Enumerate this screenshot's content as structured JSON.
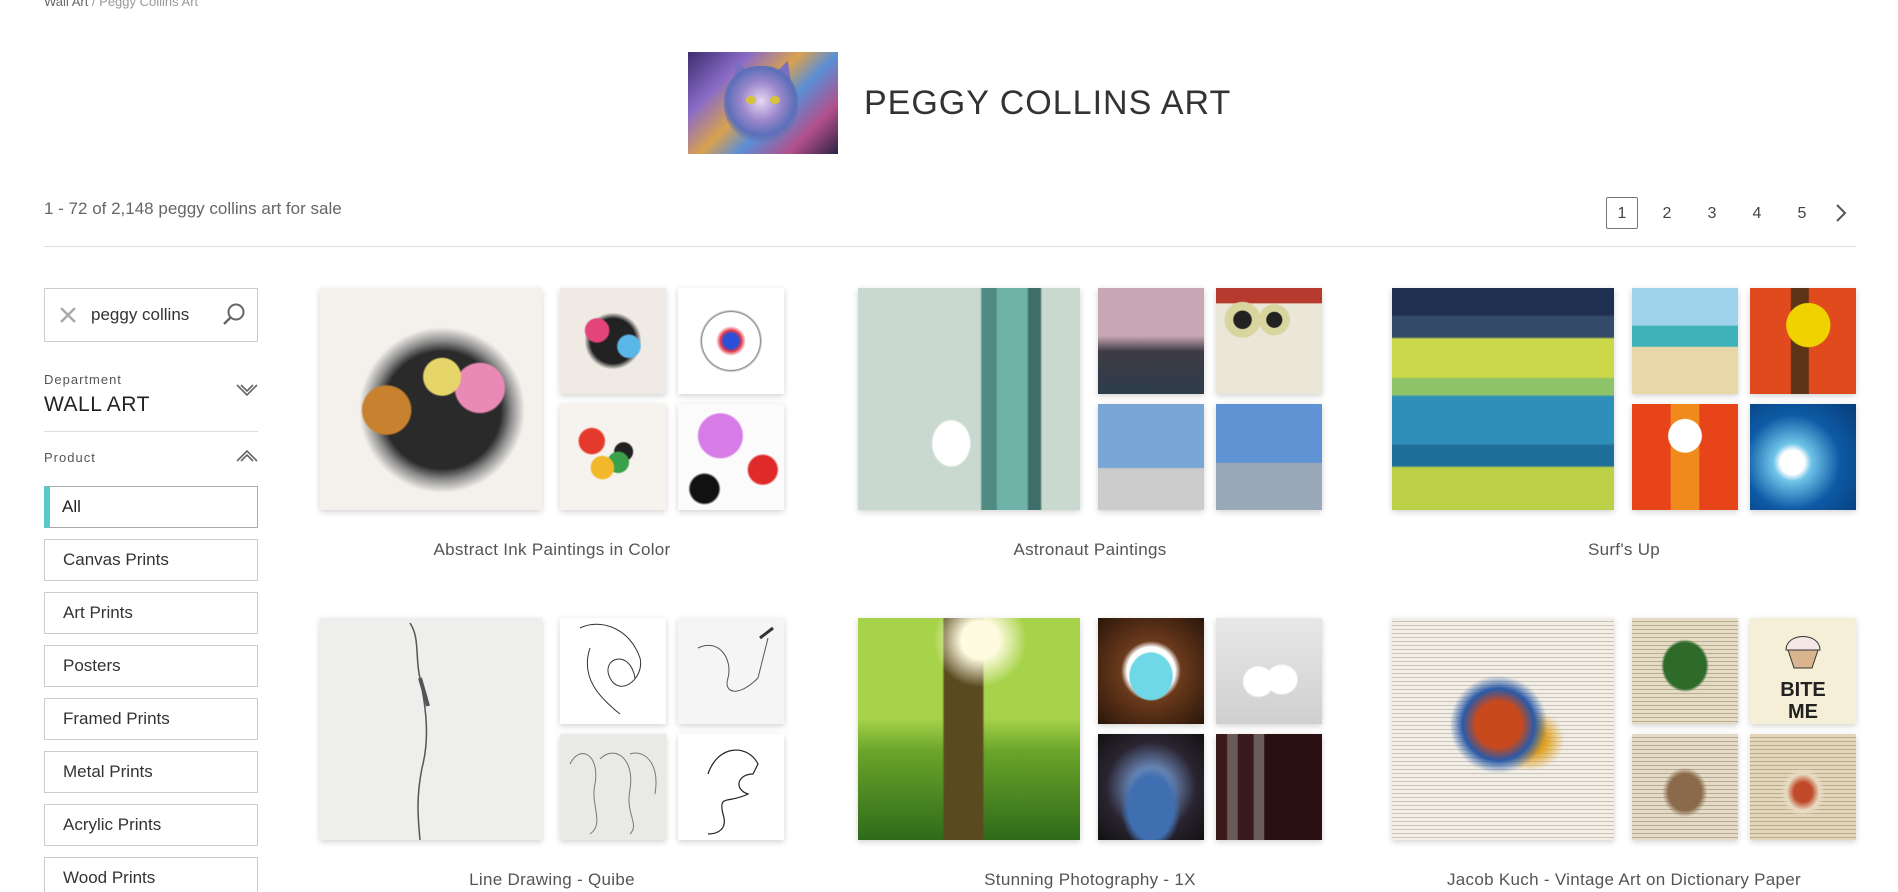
{
  "breadcrumb": {
    "parent": "Wall Art",
    "separator": " / ",
    "current": "Peggy Collins Art"
  },
  "artist": {
    "name": "PEGGY COLLINS ART"
  },
  "results": {
    "count_text": "1 - 72 of 2,148 peggy collins art for sale"
  },
  "pagination": {
    "pages": [
      "1",
      "2",
      "3",
      "4",
      "5"
    ],
    "active": "1"
  },
  "search": {
    "value": "peggy collins"
  },
  "filters": {
    "department": {
      "label": "Department",
      "value": "WALL ART"
    },
    "product": {
      "label": "Product",
      "options": [
        "All",
        "Canvas Prints",
        "Art Prints",
        "Posters",
        "Framed Prints",
        "Metal Prints",
        "Acrylic Prints",
        "Wood Prints"
      ],
      "selected": "All"
    }
  },
  "collections": [
    {
      "title": "Abstract Ink Paintings in Color"
    },
    {
      "title": "Astronaut Paintings"
    },
    {
      "title": "Surf's Up"
    },
    {
      "title": "Line Drawing - Quibe"
    },
    {
      "title": "Stunning Photography - 1X"
    },
    {
      "title": "Jacob Kuch - Vintage Art on Dictionary Paper"
    }
  ],
  "colors": {
    "accent": "#58c9c7",
    "text": "#333333",
    "border": "#cccccc"
  }
}
